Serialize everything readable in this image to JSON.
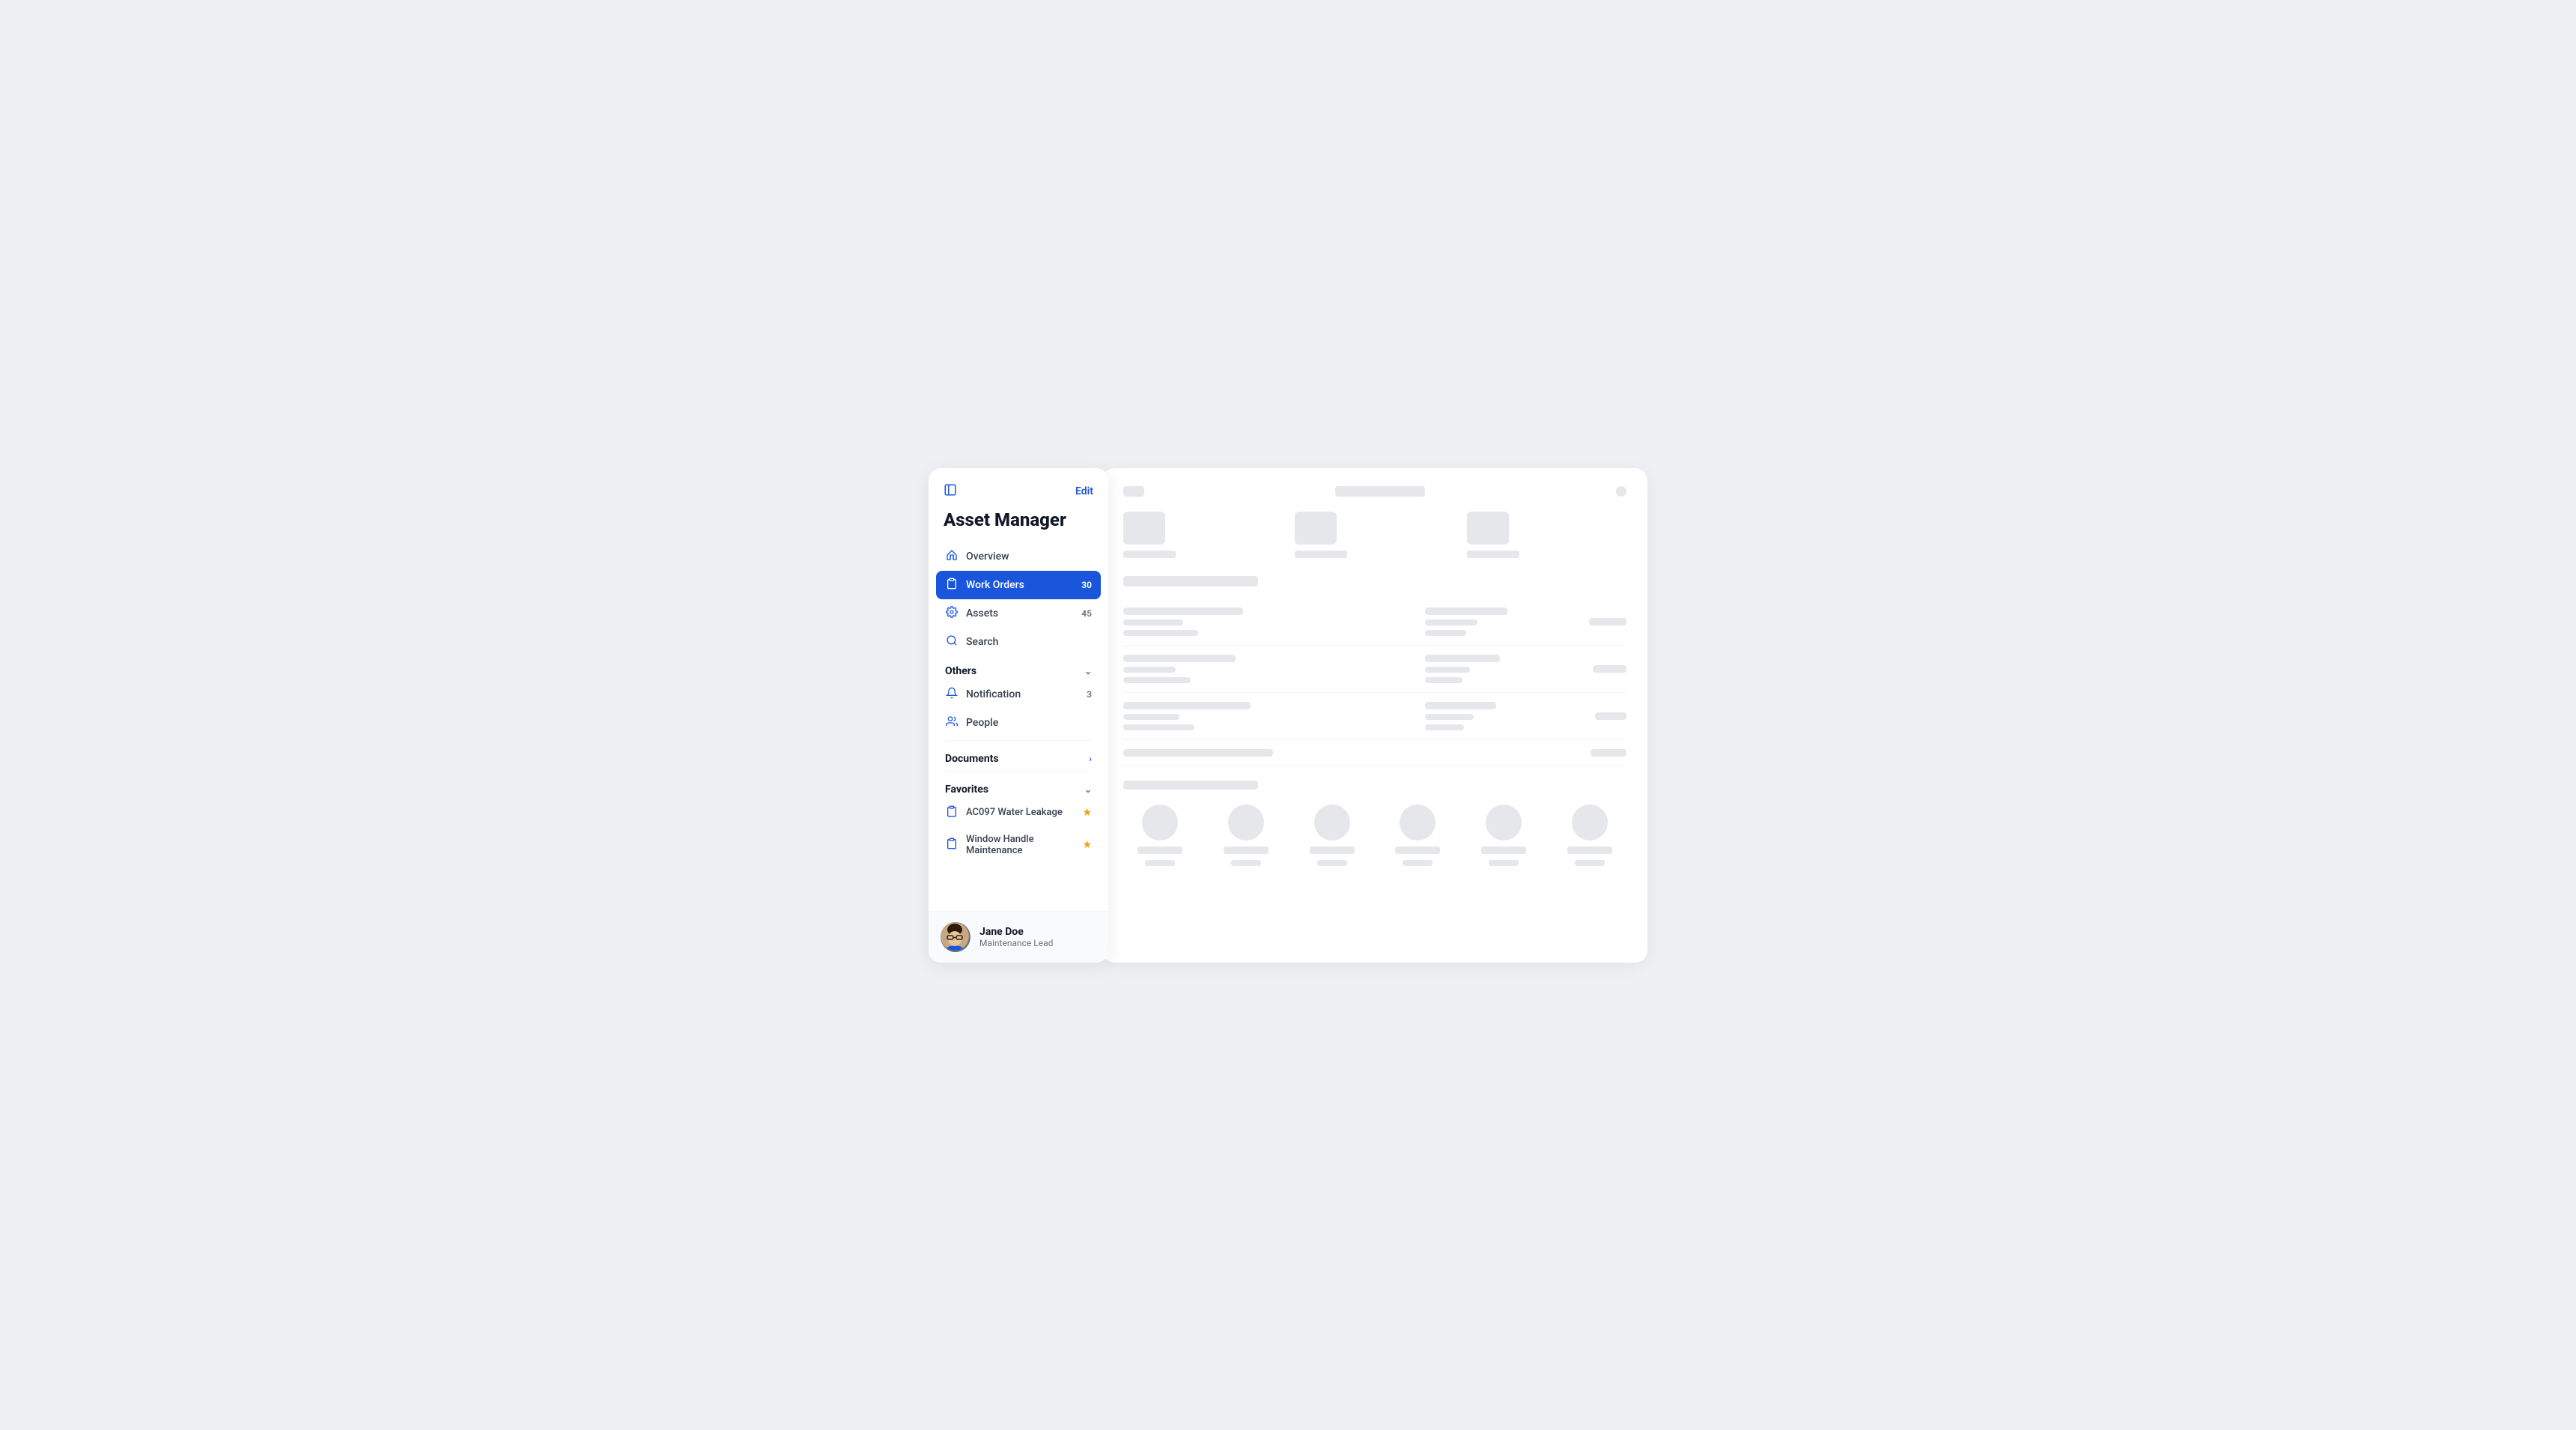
{
  "app": {
    "title": "Asset Manager"
  },
  "sidebar": {
    "edit_label": "Edit",
    "nav_items": [
      {
        "id": "overview",
        "label": "Overview",
        "icon": "home",
        "badge": null,
        "active": false
      },
      {
        "id": "work-orders",
        "label": "Work Orders",
        "icon": "clipboard",
        "badge": "30",
        "active": true
      },
      {
        "id": "assets",
        "label": "Assets",
        "icon": "gear",
        "badge": "45",
        "active": false
      },
      {
        "id": "search",
        "label": "Search",
        "icon": "search",
        "badge": null,
        "active": false
      }
    ],
    "sections": {
      "others": {
        "label": "Others",
        "expanded": true,
        "icon": "chevron-down",
        "items": [
          {
            "id": "notification",
            "label": "Notification",
            "icon": "bell",
            "badge": "3"
          },
          {
            "id": "people",
            "label": "People",
            "icon": "users",
            "badge": null
          }
        ]
      },
      "documents": {
        "label": "Documents",
        "expanded": false,
        "icon": "chevron-right"
      },
      "favorites": {
        "label": "Favorites",
        "expanded": true,
        "icon": "chevron-down",
        "items": [
          {
            "id": "water-leakage",
            "label": "AC097 Water Leakage",
            "icon": "clipboard-blue",
            "star": true
          },
          {
            "id": "window-handle",
            "label": "Window Handle Maintenance",
            "icon": "clipboard-blue",
            "star": true
          }
        ]
      }
    },
    "user": {
      "name": "Jane Doe",
      "role": "Maintenance Lead"
    }
  },
  "content": {
    "skeleton_visible": true
  }
}
